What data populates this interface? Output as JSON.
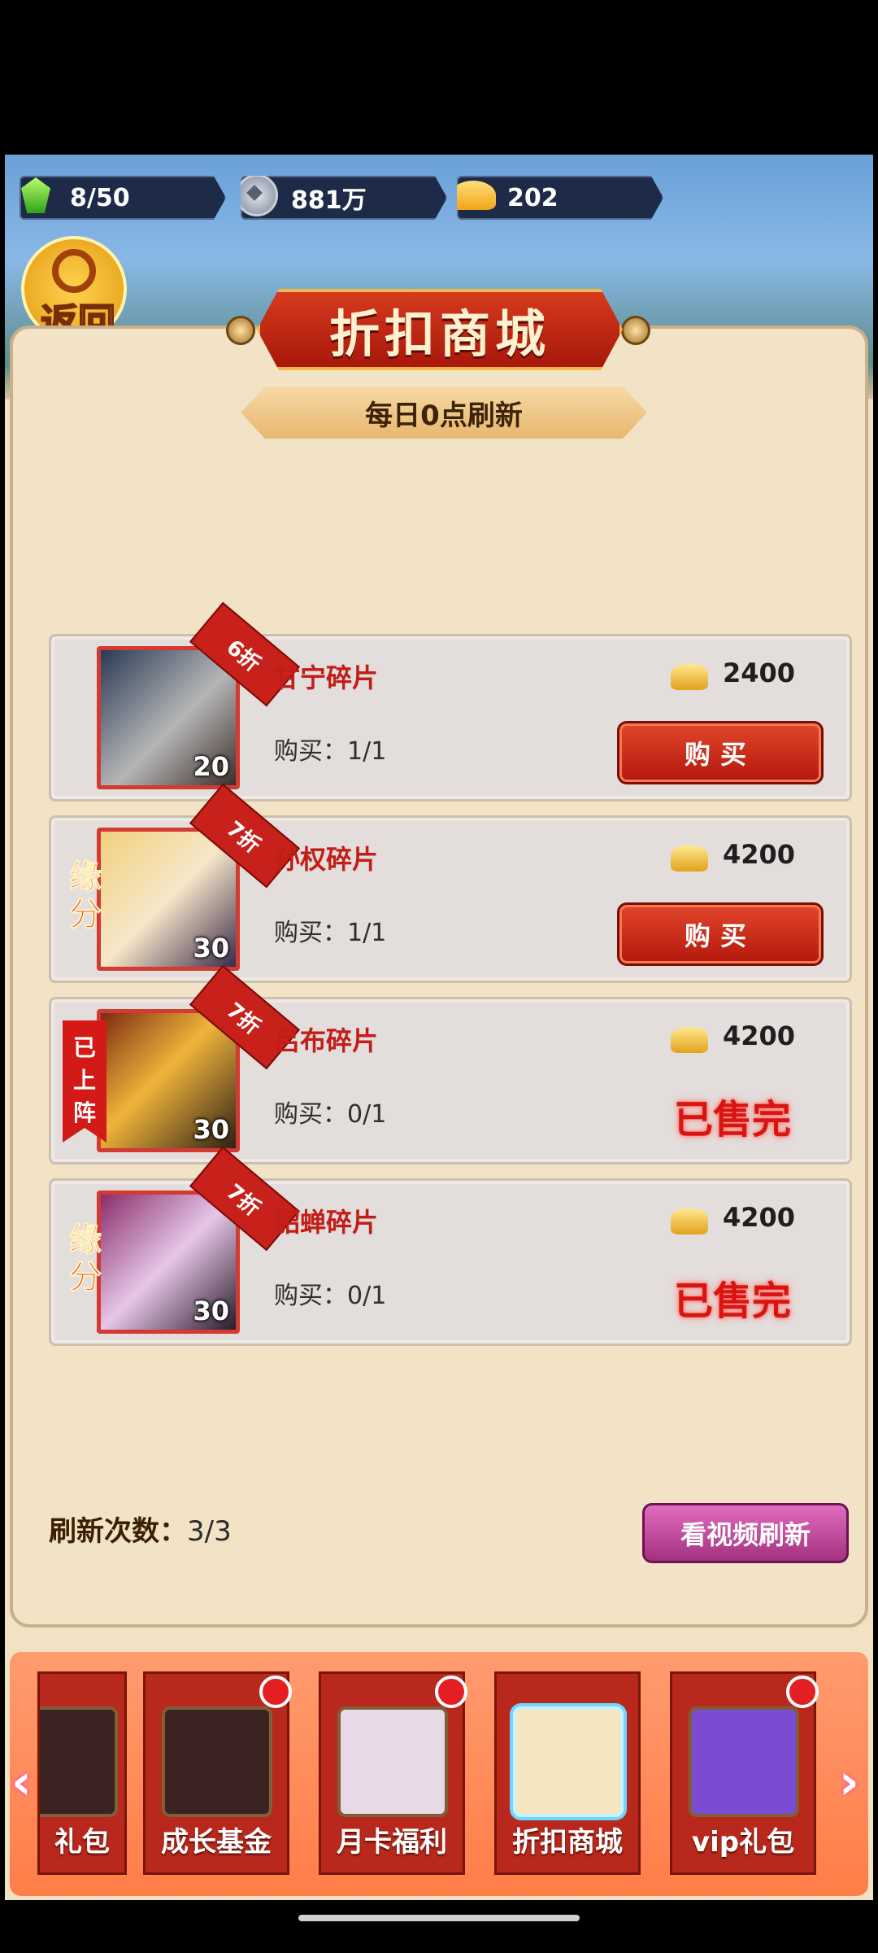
{
  "resources": {
    "gems": "8/50",
    "silver": "881万",
    "gold": "202"
  },
  "back_label": "返回",
  "title": "折扣商城",
  "refresh_note": "每日0点刷新",
  "items": [
    {
      "name": "甘宁碎片",
      "discount": "6折",
      "count": "20",
      "limit": "购买：1/1",
      "price": "2400",
      "action": "购买",
      "sold_out": false,
      "tag": ""
    },
    {
      "name": "孙权碎片",
      "discount": "7折",
      "count": "30",
      "limit": "购买：1/1",
      "price": "4200",
      "action": "购买",
      "sold_out": false,
      "tag": "缘分"
    },
    {
      "name": "吕布碎片",
      "discount": "7折",
      "count": "30",
      "limit": "购买：0/1",
      "price": "4200",
      "action": "已售完",
      "sold_out": true,
      "tag": "已上阵"
    },
    {
      "name": "貂蝉碎片",
      "discount": "7折",
      "count": "30",
      "limit": "购买：0/1",
      "price": "4200",
      "action": "已售完",
      "sold_out": true,
      "tag": "缘分"
    }
  ],
  "refresh_count_label": "刷新次数：",
  "refresh_count_value": "3/3",
  "video_refresh_label": "看视频刷新",
  "tabs": [
    {
      "label": "礼包",
      "icon": "gift-icon",
      "badge": false
    },
    {
      "label": "成长基金",
      "icon": "book-icon",
      "badge": true
    },
    {
      "label": "月卡福利",
      "icon": "month-card-icon",
      "badge": true
    },
    {
      "label": "折扣商城",
      "icon": "discount-icon",
      "badge": false,
      "active": true
    },
    {
      "label": "vip礼包",
      "icon": "vip-gift-icon",
      "badge": true
    }
  ],
  "colors": {
    "accent_red": "#c8201a",
    "panel_bg": "#f3e3c6",
    "video_button": "#c24ea0"
  }
}
